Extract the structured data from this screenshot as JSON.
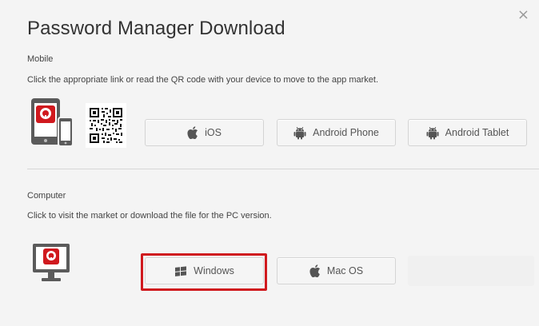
{
  "dialog": {
    "title": "Password Manager Download",
    "close_glyph": "×"
  },
  "mobile": {
    "section_label": "Mobile",
    "description": "Click the appropriate link or read the QR code with your device to move to the app market.",
    "buttons": [
      {
        "label": "iOS",
        "icon": "apple-icon"
      },
      {
        "label": "Android Phone",
        "icon": "android-icon"
      },
      {
        "label": "Android Tablet",
        "icon": "android-icon"
      }
    ]
  },
  "computer": {
    "section_label": "Computer",
    "description": "Click to visit the market or download the file for the PC version.",
    "buttons": [
      {
        "label": "Windows",
        "icon": "windows-icon",
        "highlighted": true
      },
      {
        "label": "Mac OS",
        "icon": "apple-icon"
      }
    ]
  },
  "colors": {
    "brand_red": "#d0191e",
    "highlight_border": "#d0191e",
    "text": "#444444",
    "button_bg": "#f5f5f5",
    "dialog_bg": "#f4f4f4"
  }
}
